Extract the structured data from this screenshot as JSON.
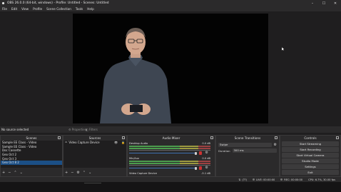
{
  "window": {
    "title": "OBS 26.0.0 (64-bit, windows) - Profile: Untitled - Scenes: Untitled",
    "controls": [
      "minimize-icon",
      "maximize-icon",
      "close-icon"
    ]
  },
  "menu": [
    "File",
    "Edit",
    "View",
    "Profile",
    "Scene Collection",
    "Tools",
    "Help"
  ],
  "source_bar": {
    "status": "No source selected",
    "properties_label": "Properties",
    "filters_label": "Filters"
  },
  "scenes": {
    "header": "Scenes",
    "items": [
      "Sample EE Class - Video",
      "Sample EE Class - Video",
      "Doc Cassette",
      "Geo Oct 2",
      "Geo Oct 3",
      "Geo Oct 8 2"
    ],
    "selected_index": 5
  },
  "sources": {
    "header": "Sources",
    "items": [
      "Video Capture Device"
    ]
  },
  "mixer": {
    "header": "Audio Mixer",
    "channels": [
      {
        "name": "Desktop Audio",
        "db": "0.0 dB",
        "level": 0.85
      },
      {
        "name": "Mic/Aux",
        "db": "0.0 dB",
        "level": 0.85
      },
      {
        "name": "Video Capture Device",
        "db": "-5.1 dB",
        "level": 0.7
      }
    ]
  },
  "transitions": {
    "header": "Scene Transitions",
    "transition": "Swipe",
    "duration_label": "Duration",
    "duration_value": "300 ms"
  },
  "controls": {
    "header": "Controls",
    "buttons": [
      "Start Streaming",
      "Start Recording",
      "Start Virtual Camera",
      "Studio Mode",
      "Settings",
      "Exit"
    ]
  },
  "status": {
    "live": "LIVE: 00:00:00",
    "rec": "REC: 00:00:00",
    "cpu": "CPU: 6.7%, 30.00 fps",
    "dropped": "(??)"
  }
}
